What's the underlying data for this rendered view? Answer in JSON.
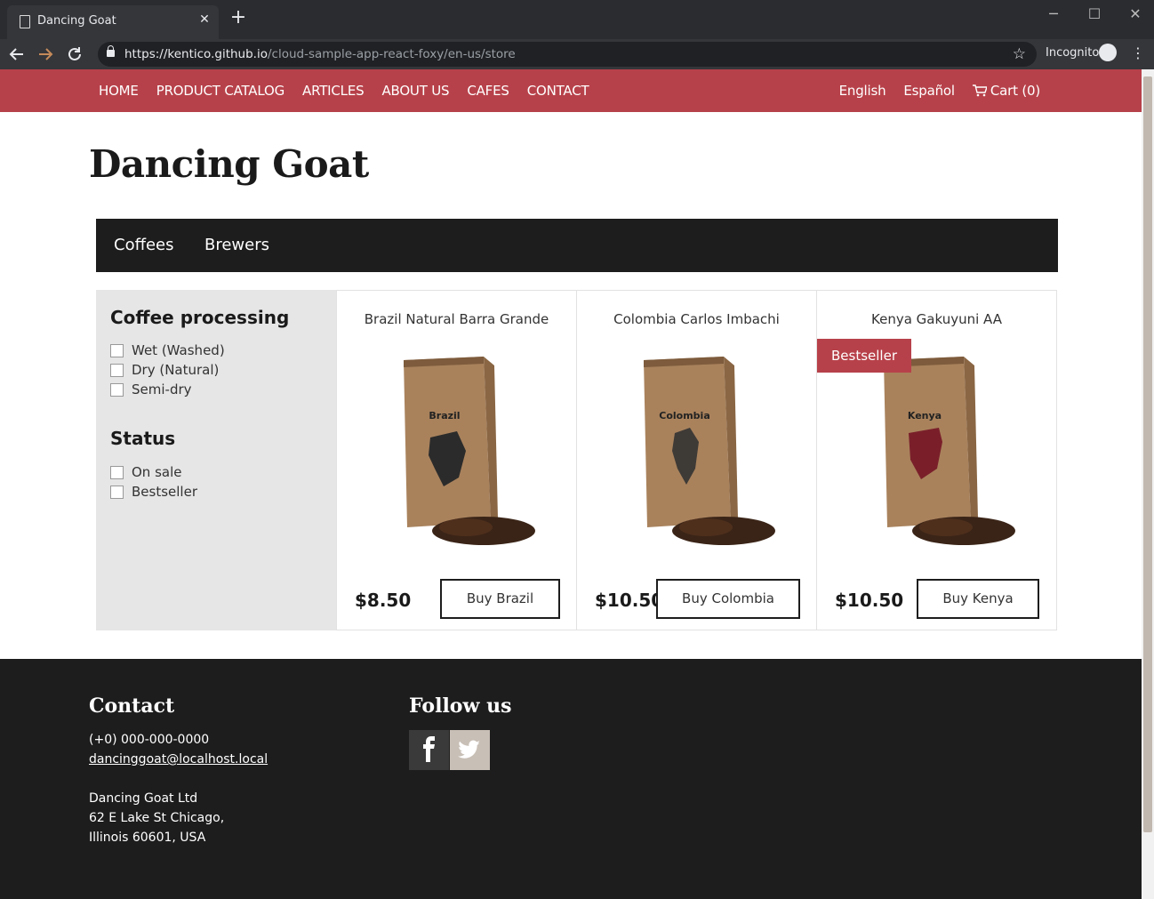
{
  "browser": {
    "tab_title": "Dancing Goat",
    "tab_close": "✕",
    "new_tab": "+",
    "url_host": "https://kentico.github.io",
    "url_path": "/cloud-sample-app-react-foxy/en-us/store",
    "incognito_label": "Incognito",
    "window_min": "─",
    "window_max": "☐",
    "window_close": "✕"
  },
  "nav": {
    "links": [
      "HOME",
      "PRODUCT CATALOG",
      "ARTICLES",
      "ABOUT US",
      "CAFES",
      "CONTACT"
    ],
    "lang_en": "English",
    "lang_es": "Español",
    "cart_label": "Cart (0)"
  },
  "brand_title": "Dancing Goat",
  "categories": [
    "Coffees",
    "Brewers"
  ],
  "filters": {
    "processing_title": "Coffee processing",
    "processing_options": [
      "Wet (Washed)",
      "Dry (Natural)",
      "Semi-dry"
    ],
    "status_title": "Status",
    "status_options": [
      "On sale",
      "Bestseller"
    ]
  },
  "products": [
    {
      "name": "Brazil Natural Barra Grande",
      "bag_label": "Brazil",
      "price": "$8.50",
      "buy_label": "Buy Brazil",
      "badge": ""
    },
    {
      "name": "Colombia Carlos Imbachi",
      "bag_label": "Colombia",
      "price": "$10.50",
      "buy_label": "Buy Colombia",
      "badge": ""
    },
    {
      "name": "Kenya Gakuyuni AA",
      "bag_label": "Kenya",
      "price": "$10.50",
      "buy_label": "Buy Kenya",
      "badge": "Bestseller"
    }
  ],
  "footer": {
    "contact_title": "Contact",
    "phone": "(+0) 000-000-0000",
    "email": "dancinggoat@localhost.local",
    "company": "Dancing Goat Ltd",
    "street": "62 E Lake St Chicago,",
    "city": "Illinois 60601, USA",
    "follow_title": "Follow us"
  },
  "colors": {
    "brand_red": "#b7414a",
    "dark": "#1d1d1d",
    "filter_bg": "#e6e6e6"
  },
  "icons": [
    "page-icon",
    "back-arrow-icon",
    "forward-arrow-icon",
    "reload-icon",
    "lock-icon",
    "star-icon",
    "incognito-icon",
    "menu-icon",
    "cart-icon",
    "facebook-icon",
    "twitter-icon"
  ]
}
